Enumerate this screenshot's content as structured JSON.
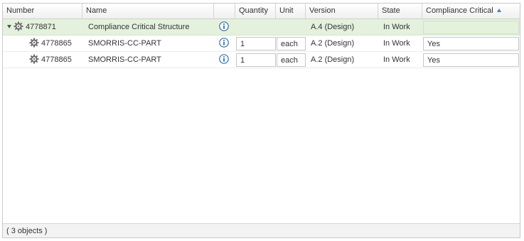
{
  "columns": {
    "number": "Number",
    "name": "Name",
    "quantity": "Quantity",
    "unit": "Unit",
    "version": "Version",
    "state": "State",
    "compliance": "Compliance Critical"
  },
  "rows": [
    {
      "number": "4778871",
      "name": "Compliance Critical Structure",
      "quantity": "",
      "unit": "",
      "version": "A.4 (Design)",
      "state": "In Work",
      "compliance": "",
      "expanded": true,
      "selected": true
    },
    {
      "number": "4778865",
      "name": "SMORRIS-CC-PART",
      "quantity": "1",
      "unit": "each",
      "version": "A.2 (Design)",
      "state": "In Work",
      "compliance": "Yes"
    },
    {
      "number": "4778865",
      "name": "SMORRIS-CC-PART",
      "quantity": "1",
      "unit": "each",
      "version": "A.2 (Design)",
      "state": "In Work",
      "compliance": "Yes"
    }
  ],
  "footer": {
    "count": "( 3 objects )"
  },
  "icons": {
    "part": "gear-icon",
    "info": "info-icon",
    "expand": "triangle-down-icon",
    "sort": "sort-ascending-icon"
  },
  "colors": {
    "selected_row": "#e4f1dd",
    "info_blue": "#2f6fb2",
    "sort_arrow": "#4a7fb5"
  }
}
